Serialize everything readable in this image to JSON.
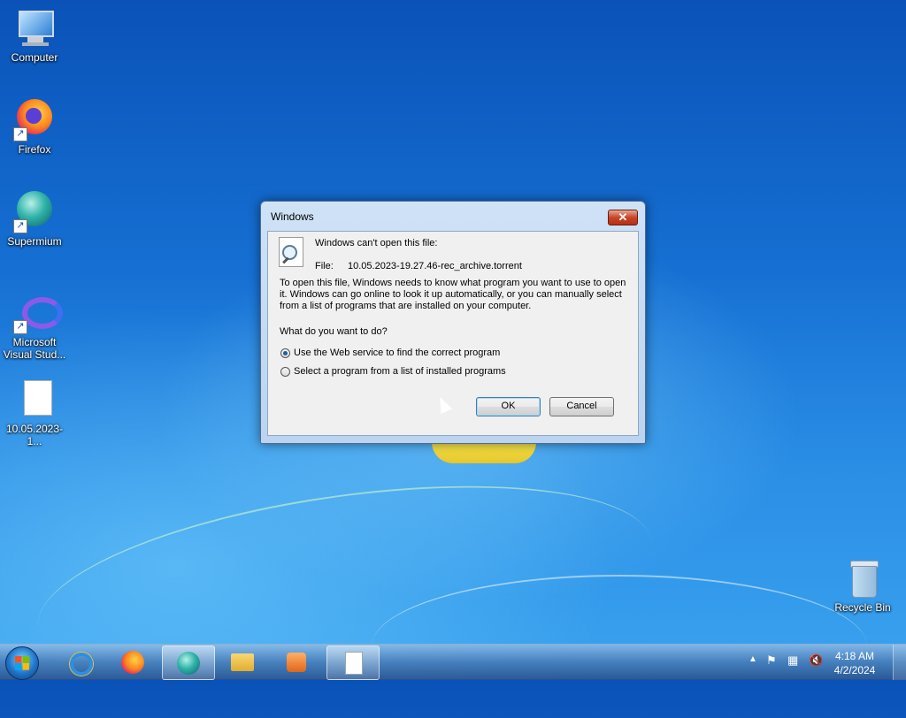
{
  "desktop": {
    "icons": [
      {
        "label": "Computer",
        "icon": "computer-icon"
      },
      {
        "label": "Firefox",
        "icon": "firefox-icon"
      },
      {
        "label": "Supermium",
        "icon": "supermium-icon"
      },
      {
        "label": "Microsoft Visual Stud...",
        "icon": "visual-studio-icon"
      },
      {
        "label": "10.05.2023-1...",
        "icon": "file-icon"
      },
      {
        "label": "Recycle Bin",
        "icon": "recycle-bin-icon"
      }
    ]
  },
  "dialog": {
    "title": "Windows",
    "close_label": "✕",
    "heading": "Windows can't open this file:",
    "file_label": "File:",
    "file_name": "10.05.2023-19.27.46-rec_archive.torrent",
    "description": "To open this file, Windows needs to know what program you want to use to open it. Windows can go online to look it up automatically, or you can manually select from a list of programs that are installed on your computer.",
    "question": "What do you want to do?",
    "options": [
      {
        "label": "Use the Web service to find the correct program",
        "selected": true
      },
      {
        "label": "Select a program from a list of installed programs",
        "selected": false
      }
    ],
    "ok_label": "OK",
    "cancel_label": "Cancel"
  },
  "taskbar": {
    "items": [
      "internet-explorer-icon",
      "firefox-icon",
      "supermium-icon",
      "file-explorer-icon",
      "media-player-icon",
      "document-icon"
    ],
    "active_item": "supermium-icon",
    "clock_time": "4:18 AM",
    "clock_date": "4/2/2024"
  }
}
